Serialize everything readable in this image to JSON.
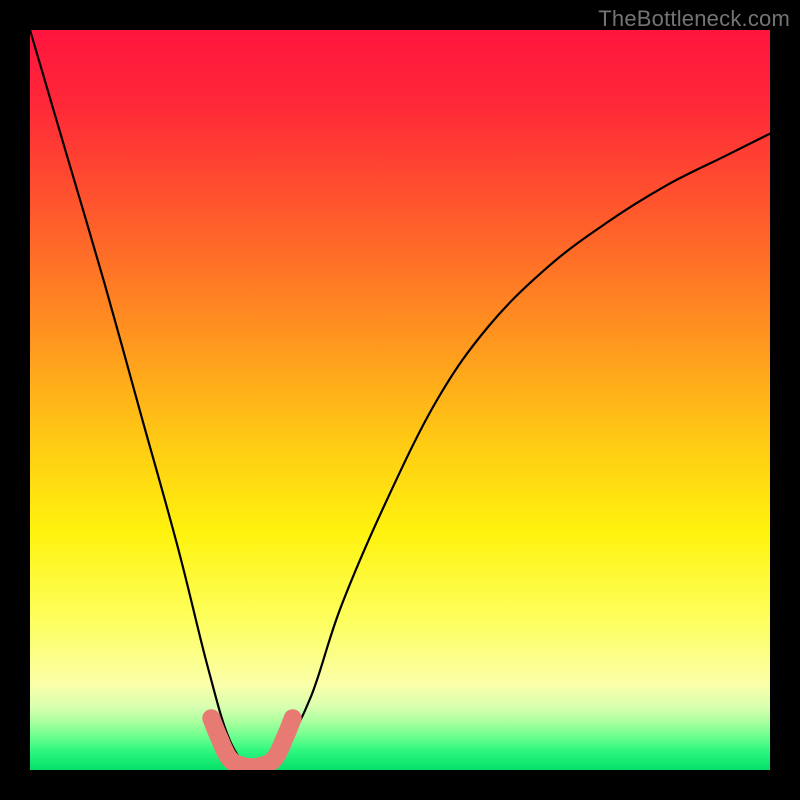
{
  "watermark": {
    "text": "TheBottleneck.com"
  },
  "gradient": {
    "stops": [
      {
        "pos": 0.0,
        "color": "#ff153e"
      },
      {
        "pos": 0.1,
        "color": "#ff2838"
      },
      {
        "pos": 0.25,
        "color": "#ff5a2c"
      },
      {
        "pos": 0.4,
        "color": "#ff8f20"
      },
      {
        "pos": 0.55,
        "color": "#ffc814"
      },
      {
        "pos": 0.68,
        "color": "#fff30e"
      },
      {
        "pos": 0.8,
        "color": "#fdff60"
      },
      {
        "pos": 0.885,
        "color": "#fbffa9"
      },
      {
        "pos": 0.915,
        "color": "#d8ffb0"
      },
      {
        "pos": 0.935,
        "color": "#a8ff9e"
      },
      {
        "pos": 0.955,
        "color": "#6cff8e"
      },
      {
        "pos": 0.975,
        "color": "#2cf67e"
      },
      {
        "pos": 1.0,
        "color": "#05e06a"
      }
    ]
  },
  "chart_data": {
    "type": "line",
    "title": "",
    "xlabel": "",
    "ylabel": "",
    "domain_note": "x spans nominal 0–100, y spans 0–100 (bottleneck %); axes hidden",
    "xlim": [
      0,
      100
    ],
    "ylim": [
      0,
      100
    ],
    "series": [
      {
        "name": "bottleneck-curve",
        "x": [
          0,
          5,
          10,
          15,
          20,
          24,
          27,
          30,
          32,
          34,
          38,
          42,
          48,
          55,
          62,
          70,
          78,
          86,
          94,
          100
        ],
        "y": [
          100,
          83,
          66,
          48,
          30,
          14,
          4,
          0,
          0,
          2,
          10,
          22,
          36,
          50,
          60,
          68,
          74,
          79,
          83,
          86
        ]
      }
    ],
    "marker_band": {
      "name": "valley-markers",
      "x": [
        24.5,
        25.5,
        27,
        29,
        31,
        33,
        34.5,
        35.5
      ],
      "y": [
        7,
        4.5,
        1.5,
        0.5,
        0.5,
        1.5,
        4.5,
        7
      ],
      "style": "thick salmon rounded stroke"
    }
  }
}
